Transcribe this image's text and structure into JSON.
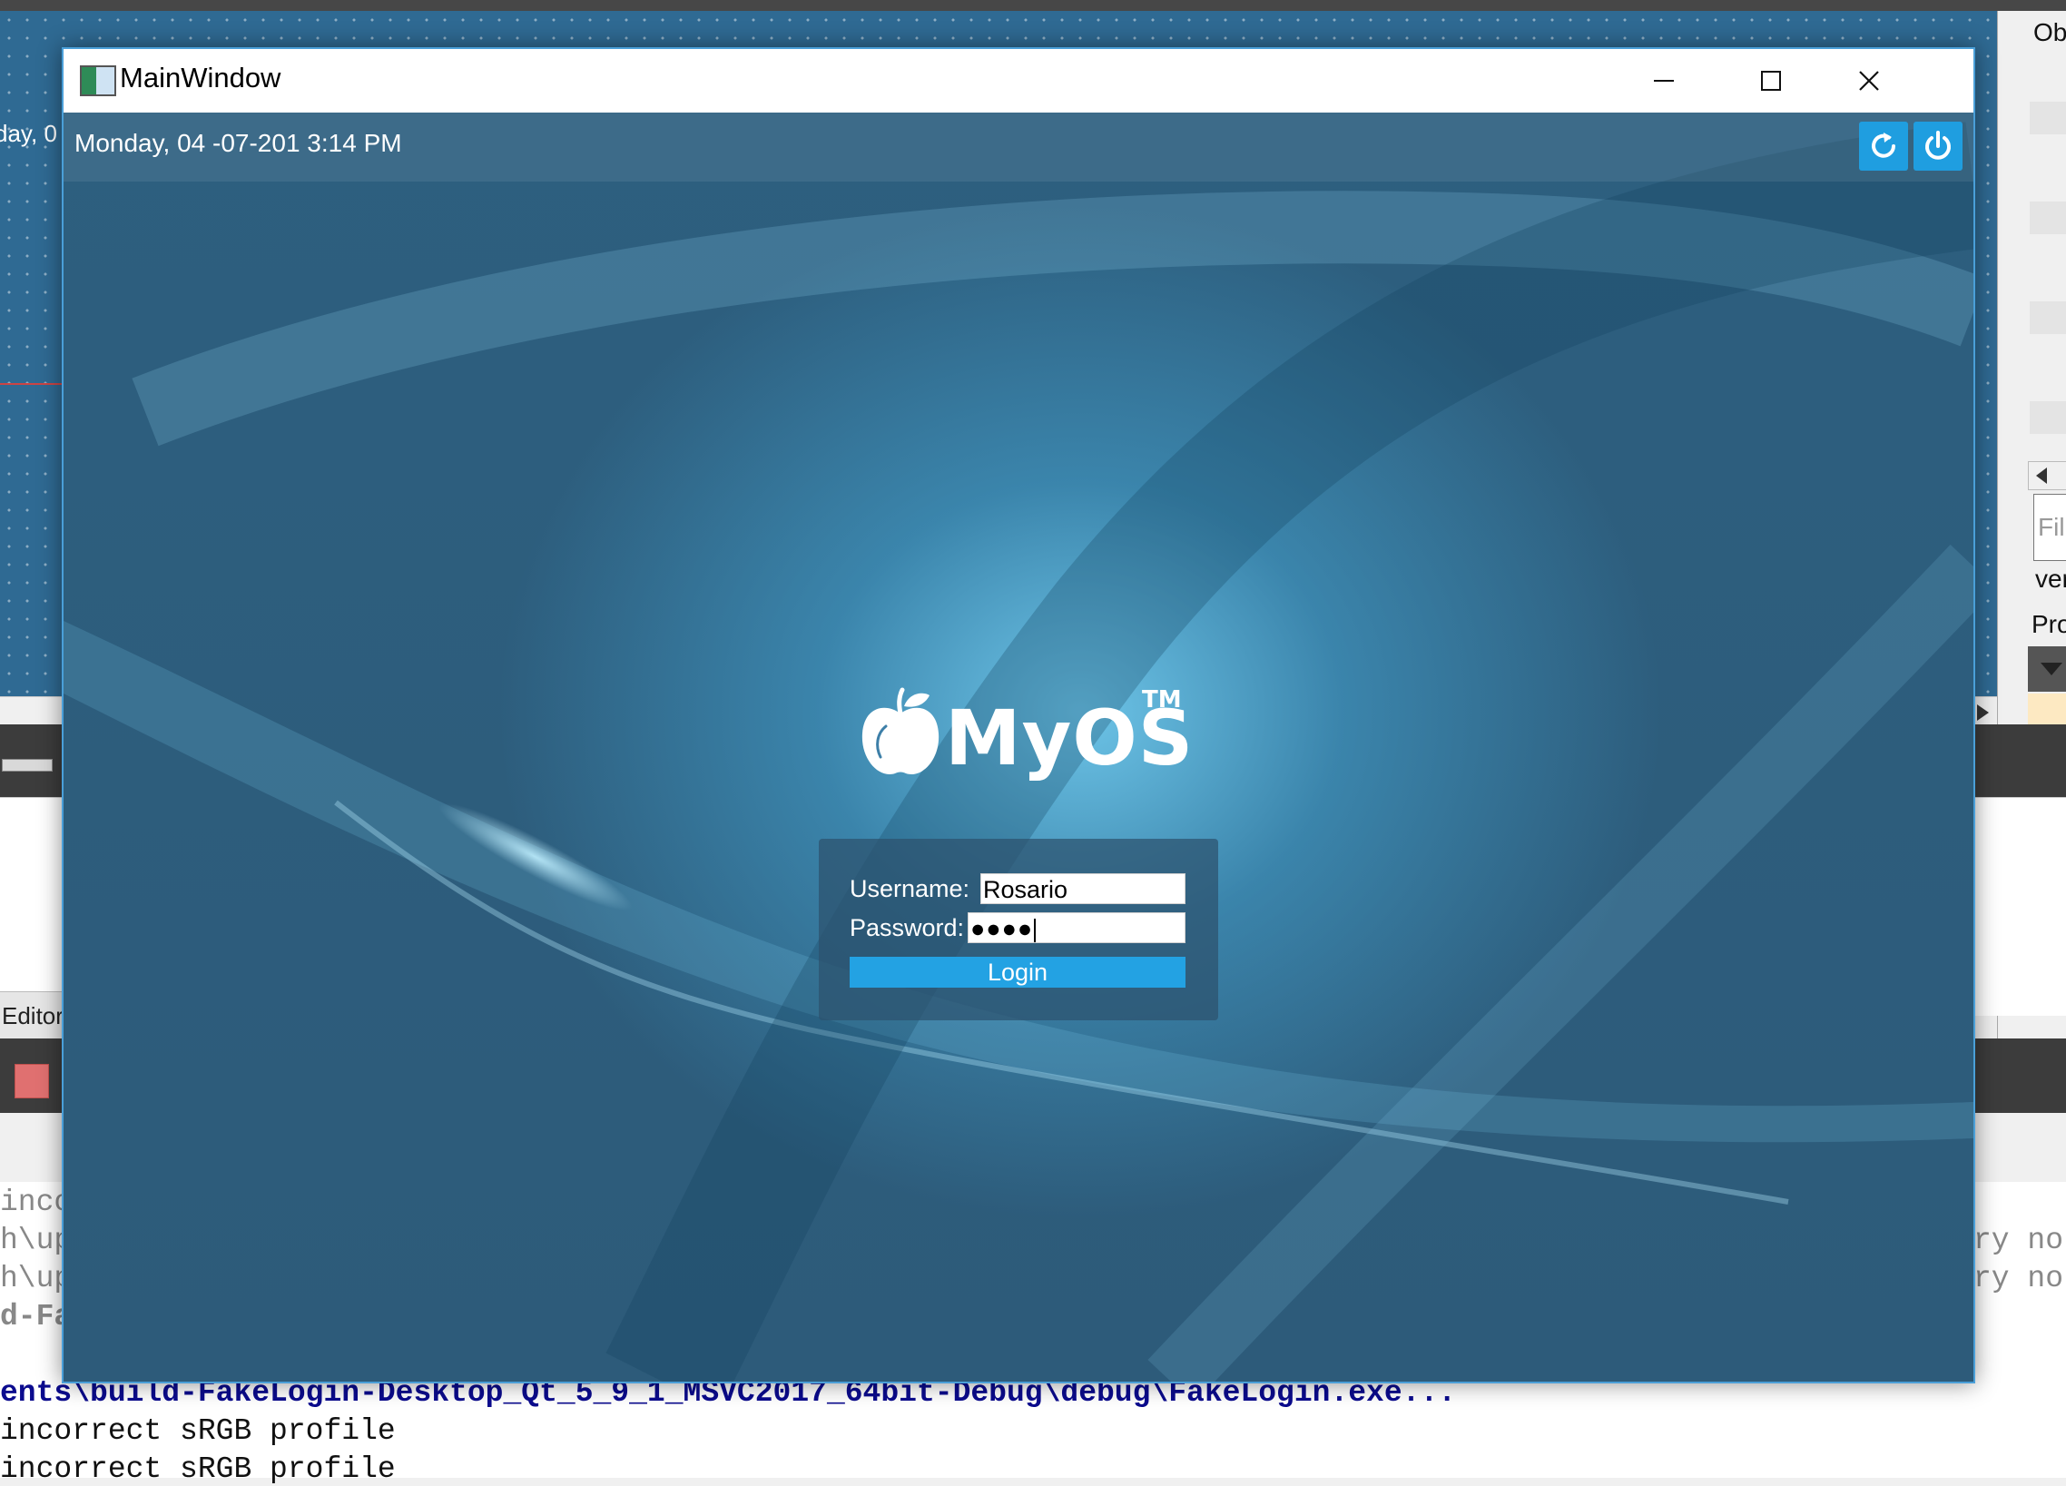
{
  "ide": {
    "designer_date_fragment": "day, 0",
    "editor_tab": "Editor",
    "output_left_fragments": [
      "inco",
      "h\\up",
      "h\\up",
      "d-Fa"
    ],
    "output_right_fragments": [
      "ry no",
      "ry no"
    ],
    "output_build_path": "ents\\build-FakeLogin-Desktop_Qt_5_9_1_MSVC2017_64bit-Debug\\debug\\FakeLogin.exe...",
    "output_lines": [
      "incorrect sRGB profile",
      "incorrect sRGB profile"
    ],
    "right_panel": {
      "top_label": "Ob",
      "filter_placeholder": "Fil",
      "item_label": "ver",
      "section_label": "Pro"
    }
  },
  "window": {
    "title": "MainWindow",
    "controls": {
      "minimize": "minimize",
      "maximize": "maximize",
      "close": "close"
    }
  },
  "login_screen": {
    "datetime": "Monday, 04 -07-201 3:14 PM",
    "refresh_icon": "refresh-icon",
    "power_icon": "power-icon",
    "logo": {
      "text": "MyOS",
      "trademark": "TM",
      "icon": "apple-icon"
    },
    "form": {
      "username_label": "Username:",
      "username_value": "Rosario",
      "password_label": "Password:",
      "password_value": "●●●●",
      "login_button": "Login"
    }
  },
  "colors": {
    "accent": "#1f9ee0",
    "window_border": "#4a9fd8",
    "background_dark": "#2d5b7a",
    "background_glow": "#78d6fa"
  }
}
